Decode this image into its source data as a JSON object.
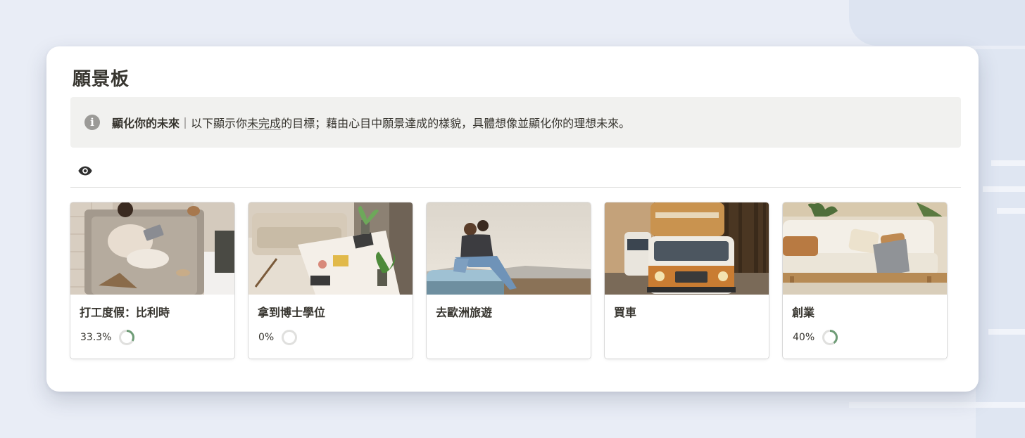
{
  "page": {
    "title": "願景板"
  },
  "callout": {
    "icon": "info-icon",
    "bold": "顯化你的未來",
    "separator": "｜",
    "text_before_link": "以下顯示你",
    "link": "未完成",
    "text_after_link": "的目標；藉由心目中願景達成的樣貌，具體想像並顯化你的理想未來。"
  },
  "toolbar": {
    "view_icon": "eye-icon"
  },
  "colors": {
    "progress_ring": "#6e9c76",
    "progress_track": "#e0e0de"
  },
  "cards": [
    {
      "title": "打工度假：比利時",
      "progress_label": "33.3%",
      "progress": 0.333,
      "cover": "woman-with-laptop-on-rug"
    },
    {
      "title": "拿到博士學位",
      "progress_label": "0%",
      "progress": 0,
      "cover": "study-desk-with-plants"
    },
    {
      "title": "去歐洲旅遊",
      "progress_label": "",
      "progress": null,
      "cover": "couple-on-car-roof"
    },
    {
      "title": "買車",
      "progress_label": "",
      "progress": null,
      "cover": "vintage-van-on-road"
    },
    {
      "title": "創業",
      "progress_label": "40%",
      "progress": 0.4,
      "cover": "sofa-with-laptop"
    }
  ]
}
